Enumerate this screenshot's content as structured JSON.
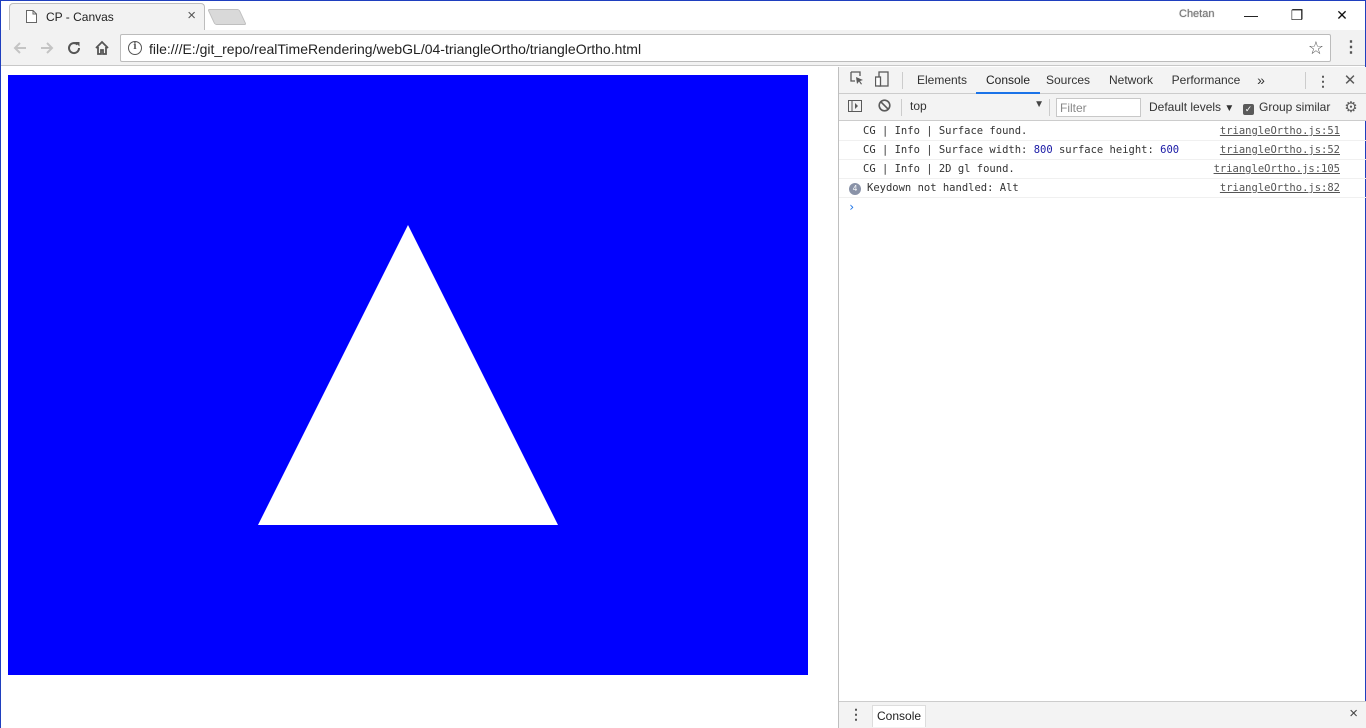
{
  "browser": {
    "tab_title": "CP - Canvas",
    "tab_close": "×",
    "user_name": "Chetan",
    "url": "file:///E:/git_repo/realTimeRendering/webGL/04-triangleOrtho/triangleOrtho.html",
    "icons": {
      "page": "page-icon",
      "back": "back-arrow-icon",
      "forward": "forward-arrow-icon",
      "reload": "reload-icon",
      "home": "home-icon",
      "info": "info-icon",
      "star": "star-icon",
      "menu": "kebab-menu-icon"
    },
    "window_controls": {
      "minimize": "—",
      "restore": "❐",
      "close": "✕"
    }
  },
  "canvas": {
    "background": "#0000ff",
    "shape_fill": "#ffffff"
  },
  "devtools": {
    "tabs": [
      "Elements",
      "Console",
      "Sources",
      "Network",
      "Performance"
    ],
    "active_tab": "Console",
    "more_tabs": "»",
    "context": "top",
    "filter_placeholder": "Filter",
    "levels": "Default levels",
    "group_similar": "Group similar",
    "messages": [
      {
        "text": "CG | Info | Surface found.",
        "source": "triangleOrtho.js:51"
      },
      {
        "text_prefix": "CG | Info | Surface width: ",
        "width": "800",
        "text_mid": " surface height: ",
        "height": "600",
        "source": "triangleOrtho.js:52"
      },
      {
        "text": "CG | Info | 2D gl found.",
        "source": "triangleOrtho.js:105"
      },
      {
        "count": "4",
        "text": "Keydown not handled: Alt",
        "source": "triangleOrtho.js:82"
      }
    ],
    "prompt": "›",
    "drawer_tab": "Console",
    "drawer_close": "×"
  }
}
